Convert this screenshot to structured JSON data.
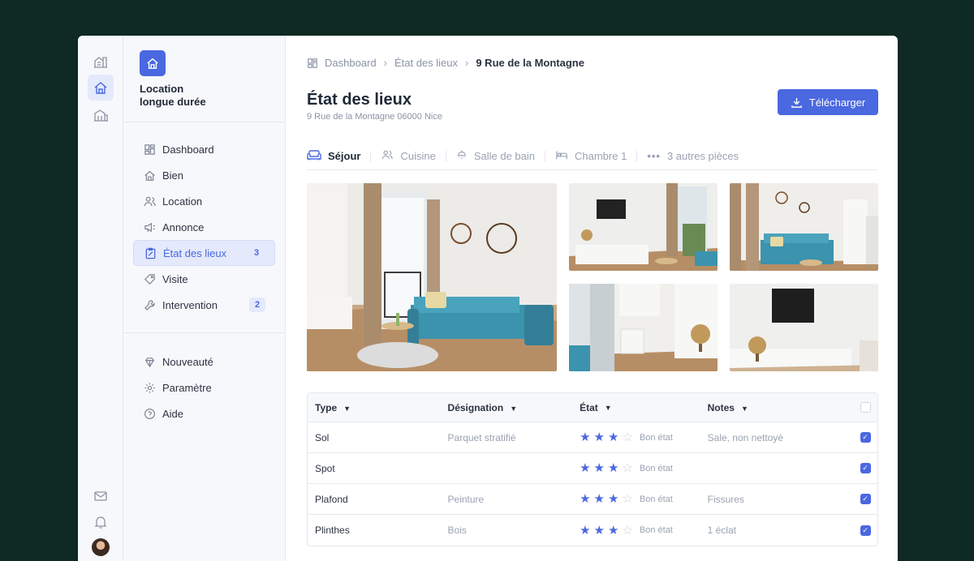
{
  "sidebar": {
    "brand": "Location\nlongue durée",
    "nav_main": [
      {
        "label": "Dashboard",
        "icon": "dashboard-icon"
      },
      {
        "label": "Bien",
        "icon": "home-icon"
      },
      {
        "label": "Location",
        "icon": "users-icon"
      },
      {
        "label": "Annonce",
        "icon": "megaphone-icon"
      },
      {
        "label": "État des lieux",
        "icon": "clipboard-icon",
        "count": "3",
        "active": true
      },
      {
        "label": "Visite",
        "icon": "tag-icon"
      },
      {
        "label": "Intervention",
        "icon": "wrench-icon",
        "count": "2"
      }
    ],
    "nav_secondary": [
      {
        "label": "Nouveauté",
        "icon": "sparkle-icon"
      },
      {
        "label": "Paramètre",
        "icon": "gear-icon"
      },
      {
        "label": "Aide",
        "icon": "help-icon"
      }
    ]
  },
  "breadcrumb": {
    "items": [
      "Dashboard",
      "État des lieux"
    ],
    "current": "9 Rue de la Montagne"
  },
  "header": {
    "title": "État des lieux",
    "address": "9 Rue de la Montagne 06000 Nice",
    "download_label": "Télécharger"
  },
  "tabs": [
    {
      "label": "Séjour",
      "icon": "sofa-icon",
      "active": true
    },
    {
      "label": "Cuisine",
      "icon": "users-icon"
    },
    {
      "label": "Salle de bain",
      "icon": "shower-icon"
    },
    {
      "label": "Chambre 1",
      "icon": "bed-icon"
    },
    {
      "label": "3 autres pièces",
      "icon": "more-icon"
    }
  ],
  "table": {
    "headers": [
      "Type",
      "Désignation",
      "État",
      "Notes"
    ],
    "rows": [
      {
        "type": "Sol",
        "designation": "Parquet stratifié",
        "rating": 3,
        "state": "Bon état",
        "notes": "Sale, non nettoyé",
        "checked": true
      },
      {
        "type": "Spot",
        "designation": "",
        "rating": 3,
        "state": "Bon état",
        "notes": "",
        "checked": true
      },
      {
        "type": "Plafond",
        "designation": "Peinture",
        "rating": 3,
        "state": "Bon état",
        "notes": "Fissures",
        "checked": true
      },
      {
        "type": "Plinthes",
        "designation": "Bois",
        "rating": 3,
        "state": "Bon état",
        "notes": "1 éclat",
        "checked": true
      }
    ],
    "max_rating": 4
  },
  "colors": {
    "accent": "#4a68e0",
    "background": "#0e2a22",
    "sofa": "#3b93ae"
  }
}
